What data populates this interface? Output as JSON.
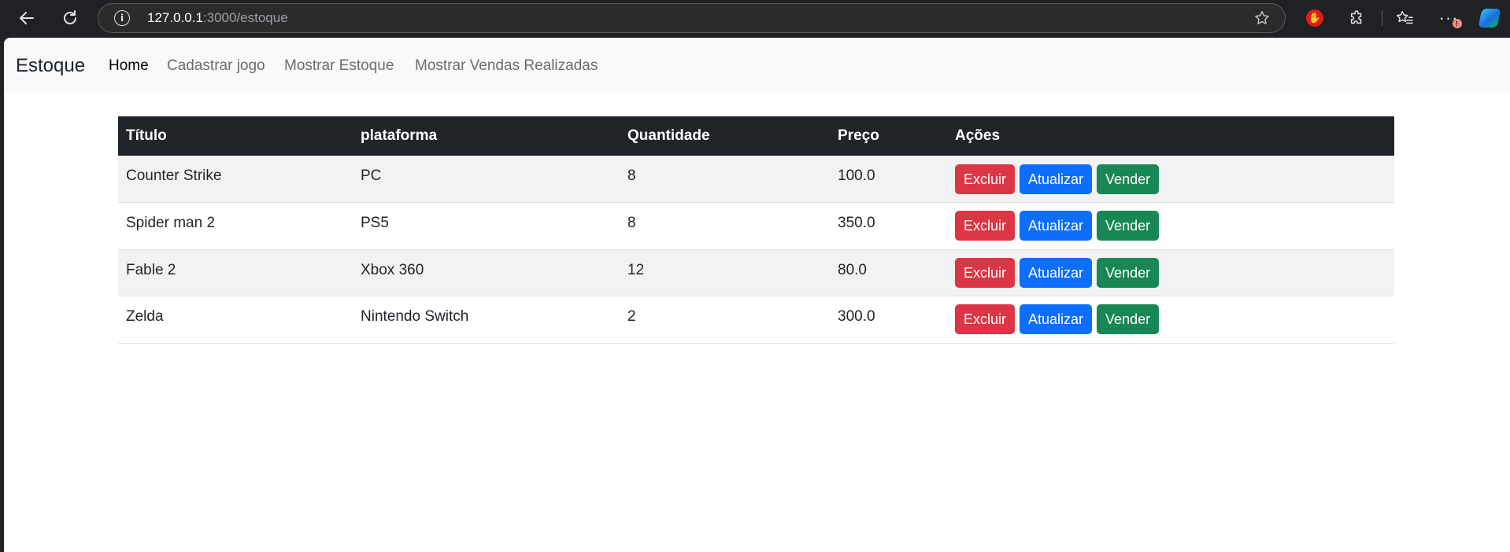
{
  "browser": {
    "url_host": "127.0.0.1",
    "url_path": ":3000/estoque",
    "more_badge": "!"
  },
  "navbar": {
    "brand": "Estoque",
    "links": [
      {
        "label": "Home",
        "active": true
      },
      {
        "label": "Cadastrar jogo",
        "active": false
      },
      {
        "label": "Mostrar Estoque",
        "active": false
      },
      {
        "label": "Mostrar Vendas Realizadas",
        "active": false
      }
    ]
  },
  "table": {
    "headers": [
      "Título",
      "plataforma",
      "Quantidade",
      "Preço",
      "Ações"
    ],
    "rows": [
      {
        "titulo": "Counter Strike",
        "plataforma": "PC",
        "quantidade": "8",
        "preco": "100.0"
      },
      {
        "titulo": "Spider man 2",
        "plataforma": "PS5",
        "quantidade": "8",
        "preco": "350.0"
      },
      {
        "titulo": "Fable 2",
        "plataforma": "Xbox 360",
        "quantidade": "12",
        "preco": "80.0"
      },
      {
        "titulo": "Zelda",
        "plataforma": "Nintendo Switch",
        "quantidade": "2",
        "preco": "300.0"
      }
    ],
    "actions": {
      "delete": "Excluir",
      "update": "Atualizar",
      "sell": "Vender"
    }
  },
  "colors": {
    "danger": "#dc3545",
    "primary": "#0d6efd",
    "success": "#198754",
    "header_bg": "#212529"
  }
}
